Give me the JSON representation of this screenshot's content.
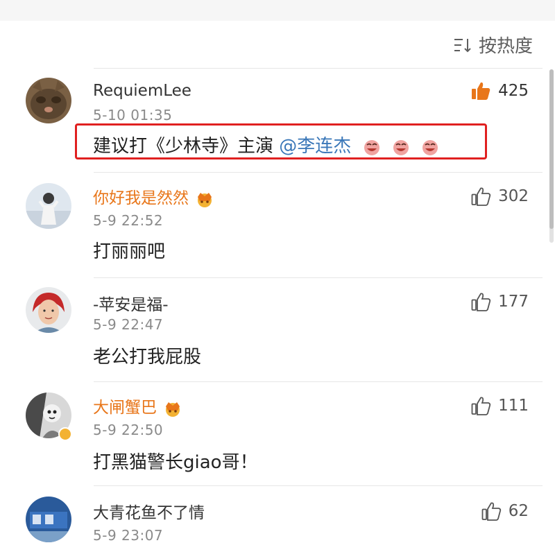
{
  "sort": {
    "label": "按热度",
    "icon": "sort-icon"
  },
  "comments": [
    {
      "username": "RequiemLee",
      "time": "5-10 01:35",
      "content_text": "建议打《少林寺》主演",
      "mention": "@李连杰",
      "emoji_count": 3,
      "likes": "425",
      "liked": true,
      "vip": false,
      "highlighted": true
    },
    {
      "username": "你好我是然然",
      "time": "5-9 22:52",
      "content": "打丽丽吧",
      "likes": "302",
      "vip": true
    },
    {
      "username": "-苹安是福-",
      "time": "5-9 22:47",
      "content": "老公打我屁股",
      "likes": "177",
      "vip": false
    },
    {
      "username": "大闸蟹巴",
      "time": "5-9 22:50",
      "content": "打黑猫警长giao哥！",
      "likes": "111",
      "vip": true,
      "verified": true
    },
    {
      "username": "大青花鱼不了情",
      "time": "5-9 23:07",
      "likes": "62",
      "vip": false
    }
  ],
  "colors": {
    "vip_name": "#e8761a",
    "mention": "#3a77b8",
    "highlight": "#e02020",
    "liked": "#e8761a"
  }
}
